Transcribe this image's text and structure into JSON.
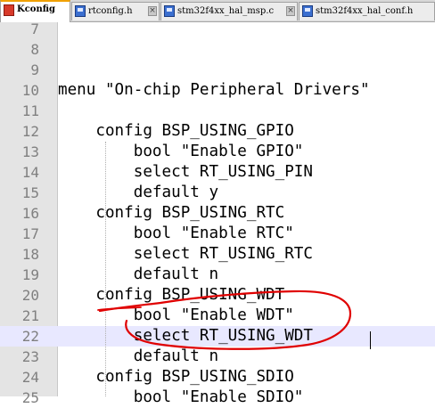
{
  "tabs": [
    {
      "label": "Kconfig",
      "icon": "file-modified-icon",
      "active": true
    },
    {
      "label": "rtconfig.h",
      "icon": "file-saved-icon",
      "active": false
    },
    {
      "label": "stm32f4xx_hal_msp.c",
      "icon": "file-saved-icon",
      "active": false
    },
    {
      "label": "stm32f4xx_hal_conf.h",
      "icon": "file-saved-icon",
      "active": false
    }
  ],
  "tab_close_glyph": "×",
  "lines": [
    {
      "num": "7",
      "text": ""
    },
    {
      "num": "8",
      "text": ""
    },
    {
      "num": "9",
      "text": ""
    },
    {
      "num": "10",
      "text": "menu \"On-chip Peripheral Drivers\""
    },
    {
      "num": "11",
      "text": ""
    },
    {
      "num": "12",
      "text": "    config BSP_USING_GPIO"
    },
    {
      "num": "13",
      "text": "        bool \"Enable GPIO\""
    },
    {
      "num": "14",
      "text": "        select RT_USING_PIN"
    },
    {
      "num": "15",
      "text": "        default y"
    },
    {
      "num": "16",
      "text": "    config BSP_USING_RTC"
    },
    {
      "num": "17",
      "text": "        bool \"Enable RTC\""
    },
    {
      "num": "18",
      "text": "        select RT_USING_RTC"
    },
    {
      "num": "19",
      "text": "        default n"
    },
    {
      "num": "20",
      "text": "    config BSP_USING_WDT"
    },
    {
      "num": "21",
      "text": "        bool \"Enable WDT\""
    },
    {
      "num": "22",
      "text": "        select RT_USING_WDT"
    },
    {
      "num": "23",
      "text": "        default n"
    },
    {
      "num": "24",
      "text": "    config BSP_USING_SDIO"
    },
    {
      "num": "25",
      "text": "        bool \"Enable SDIO\""
    }
  ],
  "current_line": "22",
  "colors": {
    "annotation": "#e00000",
    "current_line_bg": "#e8e8ff",
    "active_tab_accent": "#f0a000"
  }
}
